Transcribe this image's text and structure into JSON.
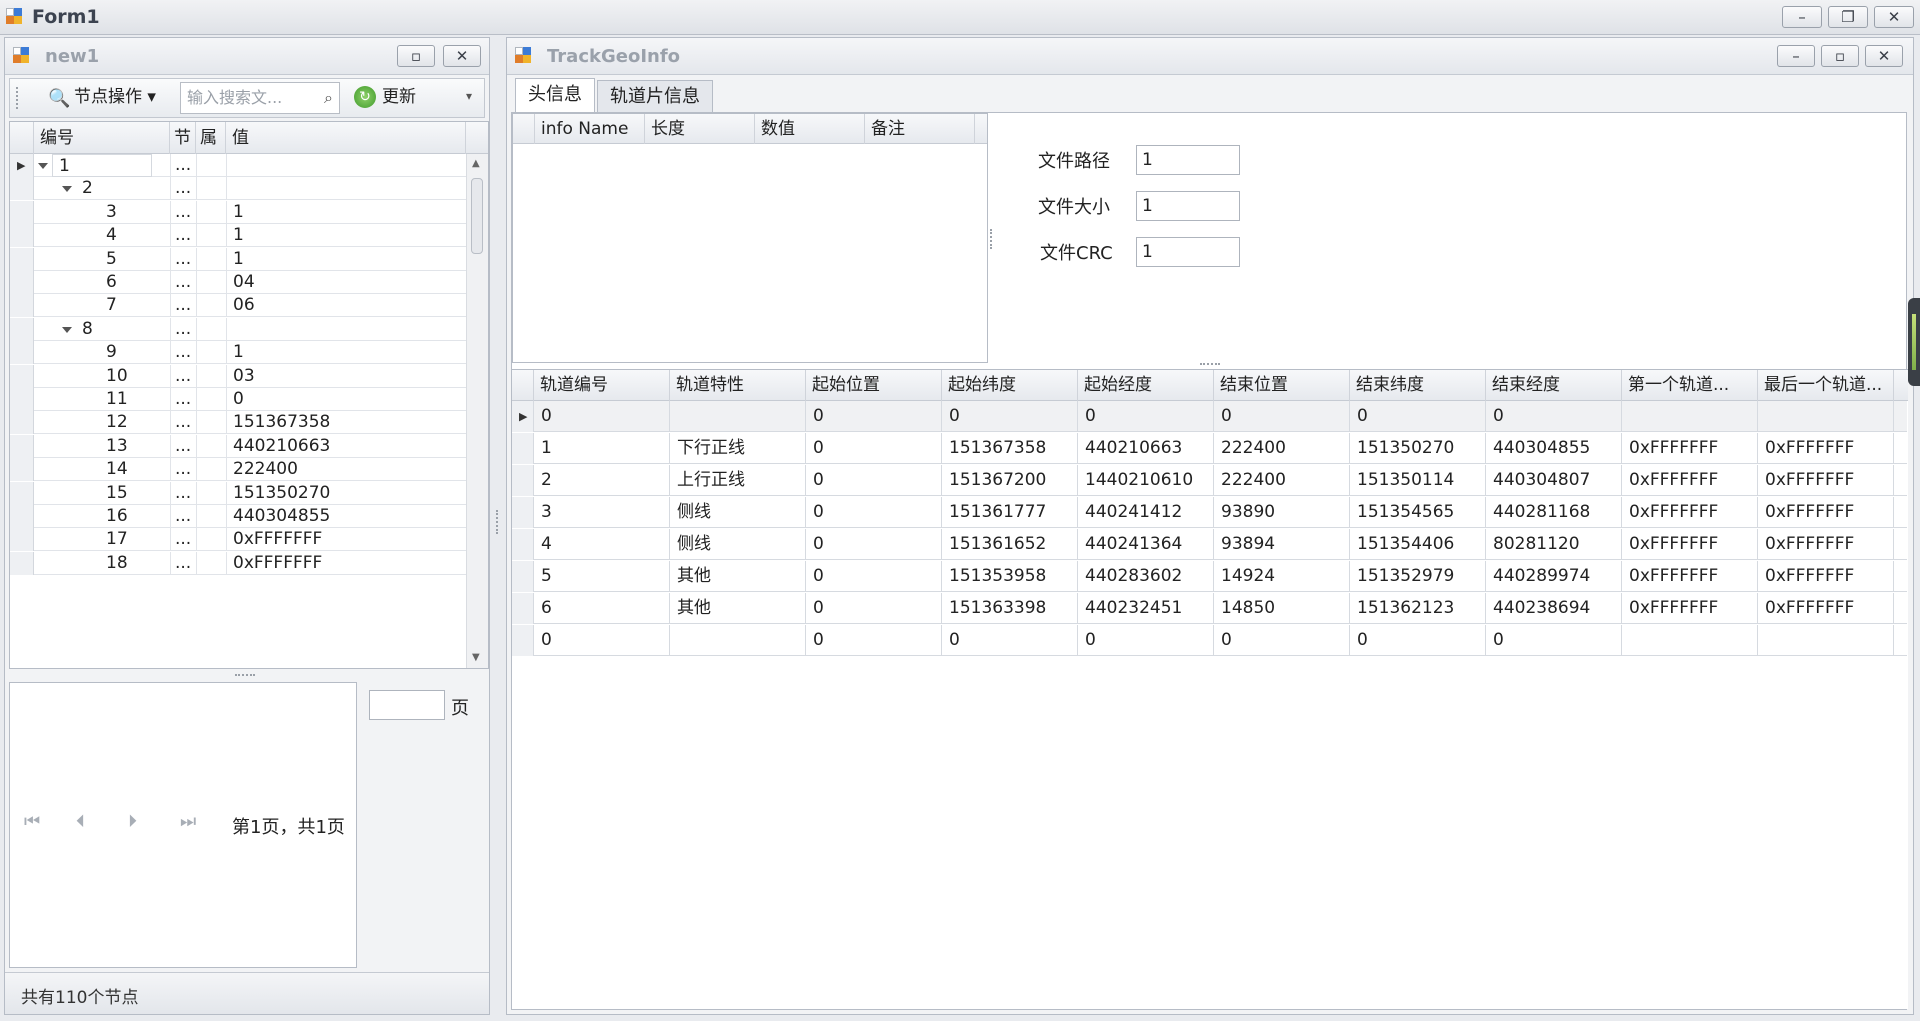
{
  "main_window": {
    "title": "Form1",
    "controls": [
      "–",
      "❐",
      "✕"
    ]
  },
  "left_window": {
    "title": "new1",
    "toolbar": {
      "node_ops_label": "节点操作",
      "search_placeholder": "输入搜索文...",
      "refresh_label": "更新"
    },
    "tree": {
      "columns": [
        "编号",
        "节",
        "属",
        "值"
      ],
      "rows": [
        {
          "id": "1",
          "sec": "...",
          "attr": "",
          "val": "",
          "level": 0,
          "expandable": true
        },
        {
          "id": "2",
          "sec": "...",
          "attr": "",
          "val": "",
          "level": 1,
          "expandable": true
        },
        {
          "id": "3",
          "sec": "...",
          "attr": "",
          "val": "1",
          "level": 2
        },
        {
          "id": "4",
          "sec": "...",
          "attr": "",
          "val": "1",
          "level": 2
        },
        {
          "id": "5",
          "sec": "...",
          "attr": "",
          "val": "1",
          "level": 2
        },
        {
          "id": "6",
          "sec": "...",
          "attr": "",
          "val": "04",
          "level": 2
        },
        {
          "id": "7",
          "sec": "...",
          "attr": "",
          "val": "06",
          "level": 2
        },
        {
          "id": "8",
          "sec": "...",
          "attr": "",
          "val": "",
          "level": 1,
          "expandable": true
        },
        {
          "id": "9",
          "sec": "...",
          "attr": "",
          "val": "1",
          "level": 2
        },
        {
          "id": "10",
          "sec": "...",
          "attr": "",
          "val": "03",
          "level": 2
        },
        {
          "id": "11",
          "sec": "...",
          "attr": "",
          "val": "0",
          "level": 2
        },
        {
          "id": "12",
          "sec": "...",
          "attr": "",
          "val": "151367358",
          "level": 2
        },
        {
          "id": "13",
          "sec": "...",
          "attr": "",
          "val": "440210663",
          "level": 2
        },
        {
          "id": "14",
          "sec": "...",
          "attr": "",
          "val": "222400",
          "level": 2
        },
        {
          "id": "15",
          "sec": "...",
          "attr": "",
          "val": "151350270",
          "level": 2
        },
        {
          "id": "16",
          "sec": "...",
          "attr": "",
          "val": "440304855",
          "level": 2
        },
        {
          "id": "17",
          "sec": "...",
          "attr": "",
          "val": "0xFFFFFFF",
          "level": 2
        },
        {
          "id": "18",
          "sec": "...",
          "attr": "",
          "val": "0xFFFFFFF",
          "level": 2
        }
      ]
    },
    "pager": {
      "page_suffix": "页",
      "page_info": "第1页，共1页",
      "page_input": ""
    },
    "status": "共有110个节点"
  },
  "right_window": {
    "title": "TrackGeoInfo",
    "tabs": [
      "头信息",
      "轨道片信息"
    ],
    "info_grid": {
      "columns": [
        "info Name",
        "长度",
        "数值",
        "备注"
      ]
    },
    "fields": [
      {
        "label": "文件路径",
        "value": "1"
      },
      {
        "label": "文件大小",
        "value": "1"
      },
      {
        "label": "文件CRC",
        "value": "1"
      }
    ],
    "track_grid": {
      "columns": [
        "轨道编号",
        "轨道特性",
        "起始位置",
        "起始纬度",
        "起始经度",
        "结束位置",
        "结束纬度",
        "结束经度",
        "第一个轨道...",
        "最后一个轨道..."
      ],
      "rows": [
        [
          "0",
          "",
          "0",
          "0",
          "0",
          "0",
          "0",
          "0",
          "",
          ""
        ],
        [
          "1",
          "下行正线",
          "0",
          "151367358",
          "440210663",
          "222400",
          "151350270",
          "440304855",
          "0xFFFFFFF",
          "0xFFFFFFF"
        ],
        [
          "2",
          "上行正线",
          "0",
          "151367200",
          "1440210610",
          "222400",
          "151350114",
          "440304807",
          "0xFFFFFFF",
          "0xFFFFFFF"
        ],
        [
          "3",
          "侧线",
          "0",
          "151361777",
          "440241412",
          "93890",
          "151354565",
          "440281168",
          "0xFFFFFFF",
          "0xFFFFFFF"
        ],
        [
          "4",
          "侧线",
          "0",
          "151361652",
          "440241364",
          "93894",
          "151354406",
          "80281120",
          "0xFFFFFFF",
          "0xFFFFFFF"
        ],
        [
          "5",
          "其他",
          "0",
          "151353958",
          "440283602",
          "14924",
          "151352979",
          "440289974",
          "0xFFFFFFF",
          "0xFFFFFFF"
        ],
        [
          "6",
          "其他",
          "0",
          "151363398",
          "440232451",
          "14850",
          "151362123",
          "440238694",
          "0xFFFFFFF",
          "0xFFFFFFF"
        ],
        [
          "0",
          "",
          "0",
          "0",
          "0",
          "0",
          "0",
          "0",
          "",
          ""
        ]
      ]
    }
  }
}
